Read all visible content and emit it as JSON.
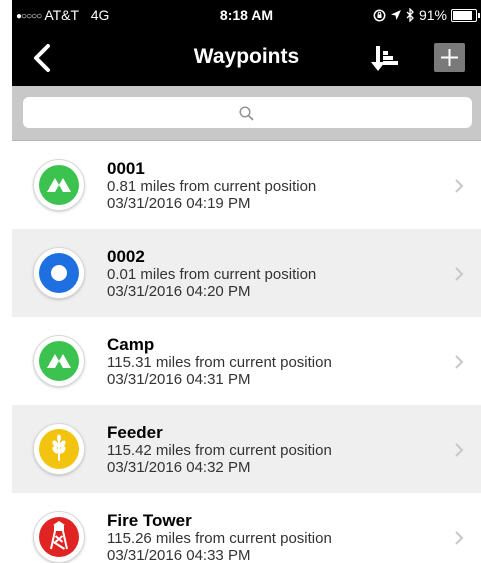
{
  "status_bar": {
    "carrier": "AT&T",
    "signal_dots": "●○○○○",
    "network": "4G",
    "time": "8:18 AM",
    "battery": "91%"
  },
  "nav": {
    "title": "Waypoints"
  },
  "search": {
    "placeholder": ""
  },
  "waypoints": [
    {
      "name": "0001",
      "distance": "0.81 miles from current position",
      "timestamp": "03/31/2016 04:19 PM",
      "icon": "tent-icon",
      "color": "#3cc24e"
    },
    {
      "name": "0002",
      "distance": "0.01 miles from current position",
      "timestamp": "03/31/2016 04:20 PM",
      "icon": "dot-icon",
      "color": "#1e6fe0"
    },
    {
      "name": "Camp",
      "distance": "115.31 miles from current position",
      "timestamp": "03/31/2016 04:31 PM",
      "icon": "tent-icon",
      "color": "#3cc24e"
    },
    {
      "name": "Feeder",
      "distance": "115.42 miles from current position",
      "timestamp": "03/31/2016 04:32 PM",
      "icon": "wheat-icon",
      "color": "#f2c40f"
    },
    {
      "name": "Fire Tower",
      "distance": "115.26 miles from current position",
      "timestamp": "03/31/2016 04:33 PM",
      "icon": "tower-icon",
      "color": "#e02424"
    }
  ]
}
